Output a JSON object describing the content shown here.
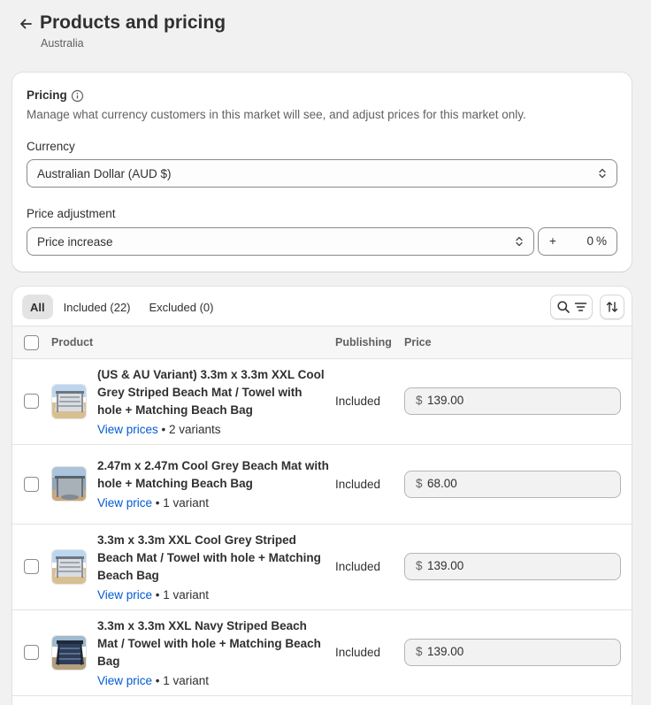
{
  "header": {
    "title": "Products and pricing",
    "subtitle": "Australia"
  },
  "pricing": {
    "heading": "Pricing",
    "description": "Manage what currency customers in this market will see, and adjust prices for this market only.",
    "currency_label": "Currency",
    "currency_value": "Australian Dollar (AUD $)",
    "adjustment_label": "Price adjustment",
    "adjustment_value": "Price increase",
    "adjustment_sign": "+",
    "adjustment_percent": "0",
    "percent_symbol": "%"
  },
  "products": {
    "tabs": [
      {
        "label": "All",
        "active": true
      },
      {
        "label": "Included (22)",
        "active": false
      },
      {
        "label": "Excluded (0)",
        "active": false
      }
    ],
    "columns": {
      "product": "Product",
      "publishing": "Publishing",
      "price": "Price"
    },
    "rows": [
      {
        "title": "(US & AU Variant) 3.3m x 3.3m XXL Cool Grey Striped Beach Mat / Towel with hole + Matching Beach Bag",
        "link": "View prices",
        "variants": "• 2 variants",
        "publishing": "Included",
        "currency": "$",
        "price": "139.00"
      },
      {
        "title": "2.47m x 2.47m Cool Grey Beach Mat with hole + Matching Beach Bag",
        "link": "View price",
        "variants": "• 1 variant",
        "publishing": "Included",
        "currency": "$",
        "price": "68.00"
      },
      {
        "title": "3.3m x 3.3m XXL Cool Grey Striped Beach Mat / Towel with hole + Matching Beach Bag",
        "link": "View price",
        "variants": "• 1 variant",
        "publishing": "Included",
        "currency": "$",
        "price": "139.00"
      },
      {
        "title": "3.3m x 3.3m XXL Navy Striped Beach Mat / Towel with hole + Matching Beach Bag",
        "link": "View price",
        "variants": "• 1 variant",
        "publishing": "Included",
        "currency": "$",
        "price": "139.00"
      }
    ]
  },
  "icons": {
    "back": "arrow-left-icon",
    "info": "info-icon",
    "select_chevron": "chevron-up-down-icon",
    "search": "search-icon",
    "filter": "filter-icon",
    "sort": "sort-icon"
  },
  "colors": {
    "link": "#005bd3",
    "page_bg": "#f1f1f1",
    "active_tab_bg": "#e3e3e3"
  }
}
